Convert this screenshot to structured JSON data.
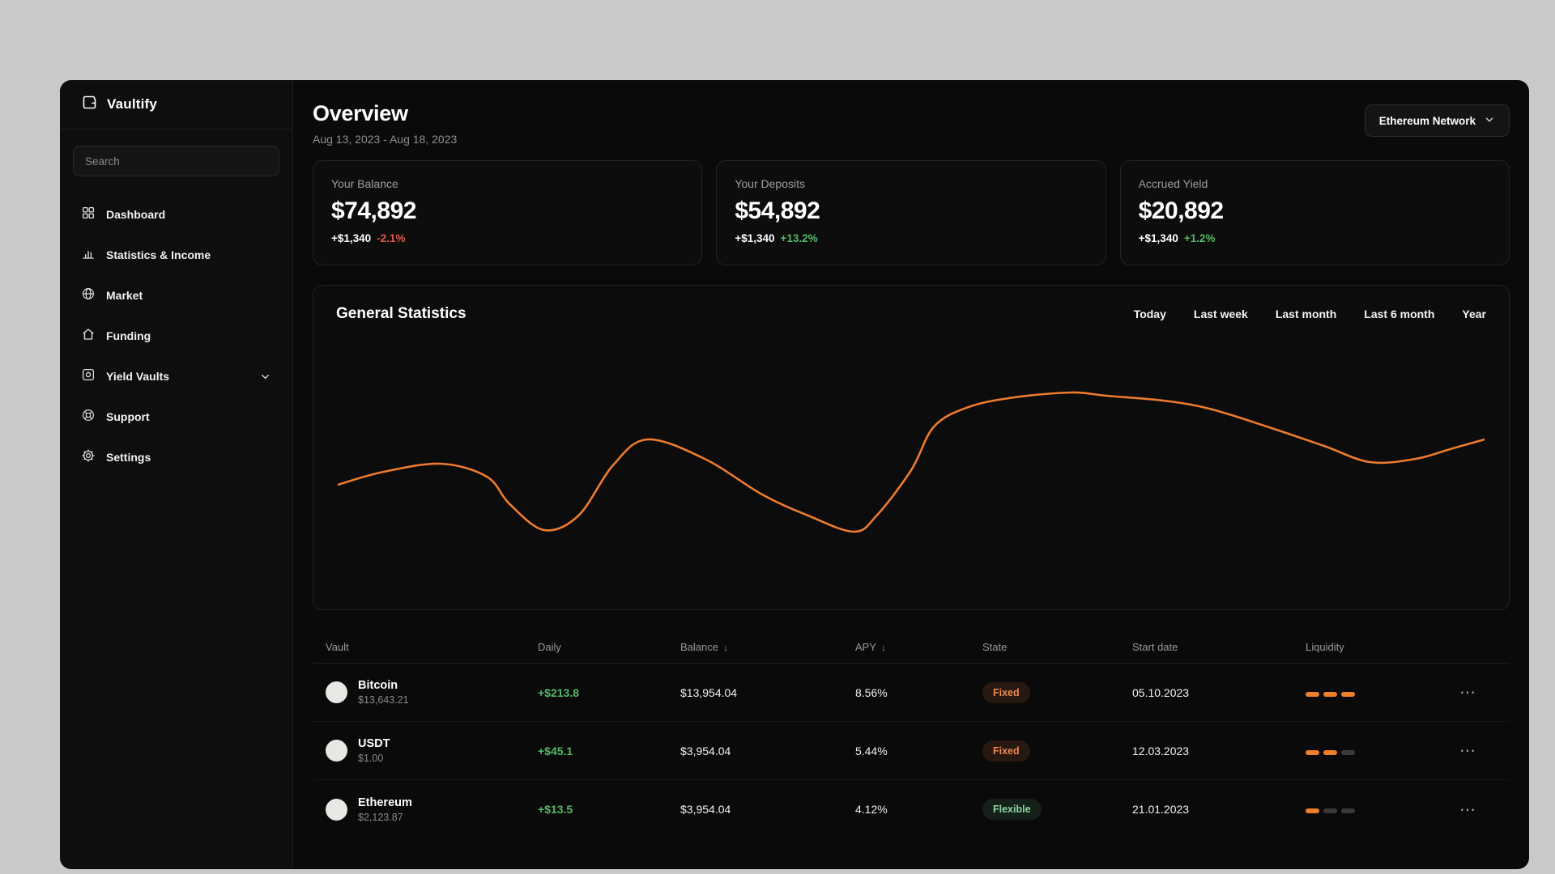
{
  "icons": {
    "sort_desc": "↓",
    "ellipsis": "⋯"
  },
  "app": {
    "name": "Vaultify"
  },
  "sidebar": {
    "search": {
      "placeholder": "Search"
    },
    "items": [
      {
        "label": "Dashboard"
      },
      {
        "label": "Statistics & Income"
      },
      {
        "label": "Market"
      },
      {
        "label": "Funding"
      },
      {
        "label": "Yield Vaults"
      },
      {
        "label": "Support"
      },
      {
        "label": "Settings"
      }
    ]
  },
  "header": {
    "title": "Overview",
    "date_range": "Aug 13, 2023 - Aug 18, 2023",
    "network": "Ethereum Network"
  },
  "stat_cards": [
    {
      "label": "Your Balance",
      "value": "$74,892",
      "change_amount": "+$1,340",
      "change_percent": "-2.1%",
      "trend": "down"
    },
    {
      "label": "Your Deposits",
      "value": "$54,892",
      "change_amount": "+$1,340",
      "change_percent": "+13.2%",
      "trend": "up"
    },
    {
      "label": "Accrued Yield",
      "value": "$20,892",
      "change_amount": "+$1,340",
      "change_percent": "+1.2%",
      "trend": "up"
    }
  ],
  "statistics": {
    "title": "General Statistics",
    "tabs": [
      "Today",
      "Last week",
      "Last month",
      "Last 6 month",
      "Year"
    ]
  },
  "chart_data": {
    "type": "line",
    "title": "General Statistics",
    "series_color": "#ed7b2f",
    "axes_visible": false,
    "legend": "none",
    "x_range": [
      0,
      100
    ],
    "y_range": [
      0,
      100
    ],
    "points": [
      [
        0,
        43
      ],
      [
        4,
        51
      ],
      [
        9,
        56
      ],
      [
        13,
        48
      ],
      [
        15,
        31
      ],
      [
        18,
        15
      ],
      [
        21,
        24
      ],
      [
        24,
        55
      ],
      [
        27,
        71
      ],
      [
        32,
        59
      ],
      [
        37,
        37
      ],
      [
        41,
        24
      ],
      [
        45,
        14
      ],
      [
        47,
        24
      ],
      [
        50,
        52
      ],
      [
        52,
        79
      ],
      [
        55,
        91
      ],
      [
        59,
        97
      ],
      [
        64,
        100
      ],
      [
        67,
        98
      ],
      [
        72,
        95
      ],
      [
        76,
        90
      ],
      [
        81,
        79
      ],
      [
        86,
        67
      ],
      [
        90,
        57
      ],
      [
        94,
        59
      ],
      [
        97,
        65
      ],
      [
        100,
        71
      ]
    ]
  },
  "table": {
    "headers": [
      "Vault",
      "Daily",
      "Balance",
      "APY",
      "State",
      "Start date",
      "Liquidity"
    ],
    "rows": [
      {
        "name": "Bitcoin",
        "price": "$13,643.21",
        "daily": "+$213.8",
        "balance": "$13,954.04",
        "apy": "8.56%",
        "state": {
          "label": "Fixed",
          "variant": "fixed"
        },
        "start_date": "05.10.2023",
        "liquidity": {
          "active": 3,
          "total": 3
        }
      },
      {
        "name": "USDT",
        "price": "$1.00",
        "daily": "+$45.1",
        "balance": "$3,954.04",
        "apy": "5.44%",
        "state": {
          "label": "Fixed",
          "variant": "fixed"
        },
        "start_date": "12.03.2023",
        "liquidity": {
          "active": 2,
          "total": 3
        }
      },
      {
        "name": "Ethereum",
        "price": "$2,123.87",
        "daily": "+$13.5",
        "balance": "$3,954.04",
        "apy": "4.12%",
        "state": {
          "label": "Flexible",
          "variant": "flexible"
        },
        "start_date": "21.01.2023",
        "liquidity": {
          "active": 1,
          "total": 3
        }
      }
    ]
  }
}
